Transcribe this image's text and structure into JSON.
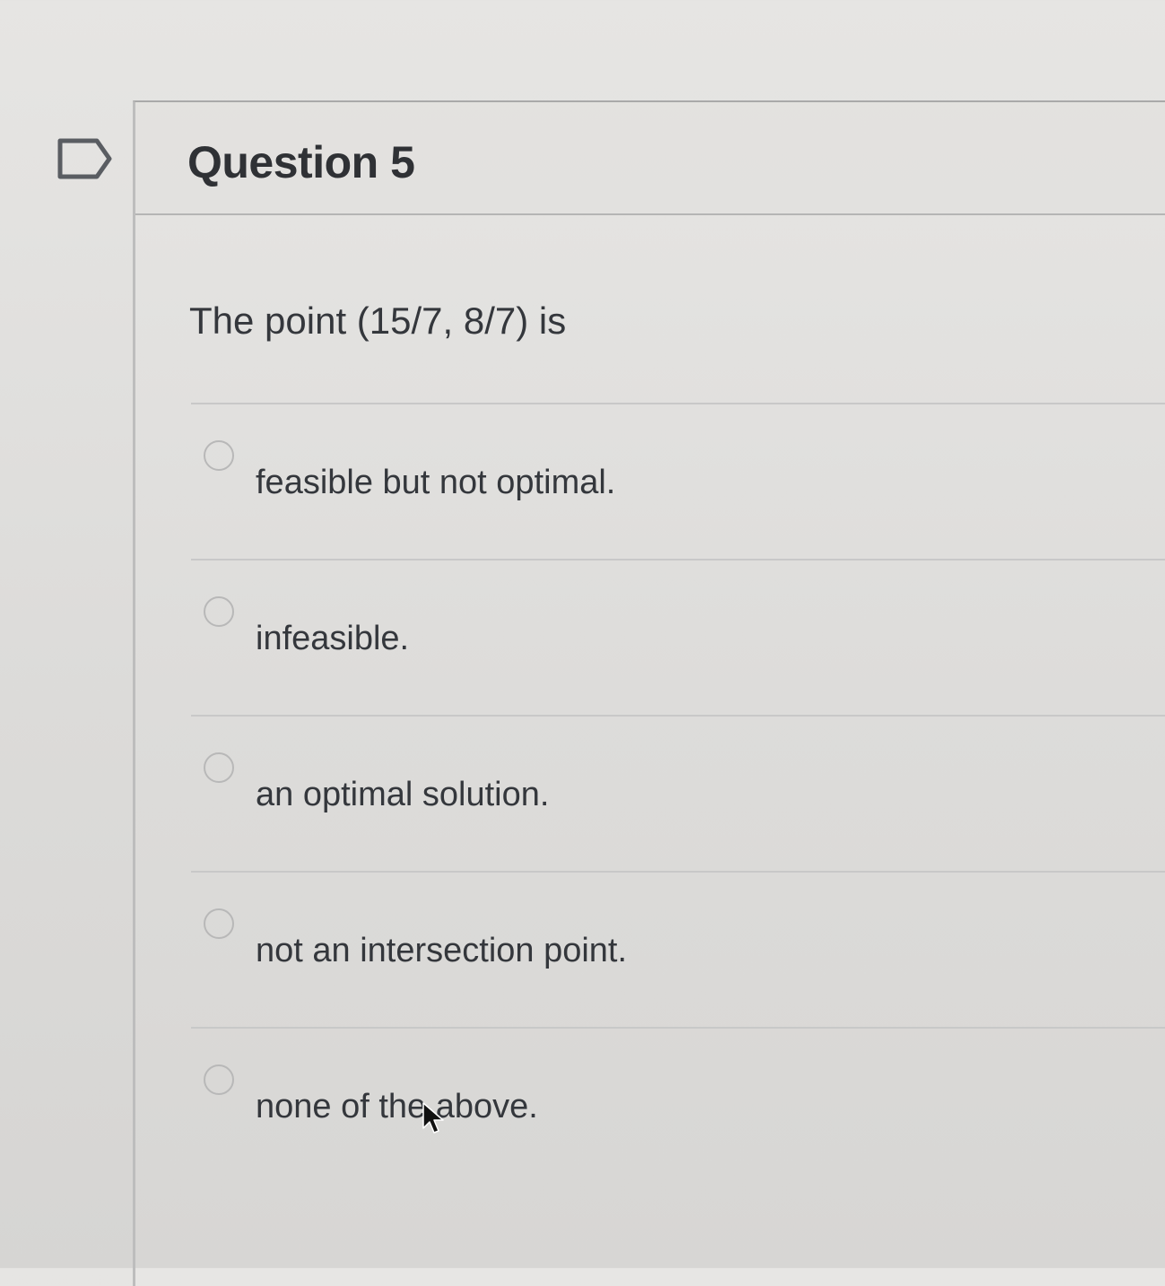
{
  "question": {
    "title": "Question 5",
    "text": "The point (15/7, 8/7) is"
  },
  "answers": [
    {
      "label": "feasible but not optimal.",
      "selected": false
    },
    {
      "label": "infeasible.",
      "selected": false
    },
    {
      "label": "an optimal solution.",
      "selected": false
    },
    {
      "label": "not an intersection point.",
      "selected": false
    },
    {
      "label": "none of the above.",
      "selected": false
    }
  ],
  "icons": {
    "flag": "flag-outline-icon",
    "pointer": "mouse-pointer-icon"
  }
}
